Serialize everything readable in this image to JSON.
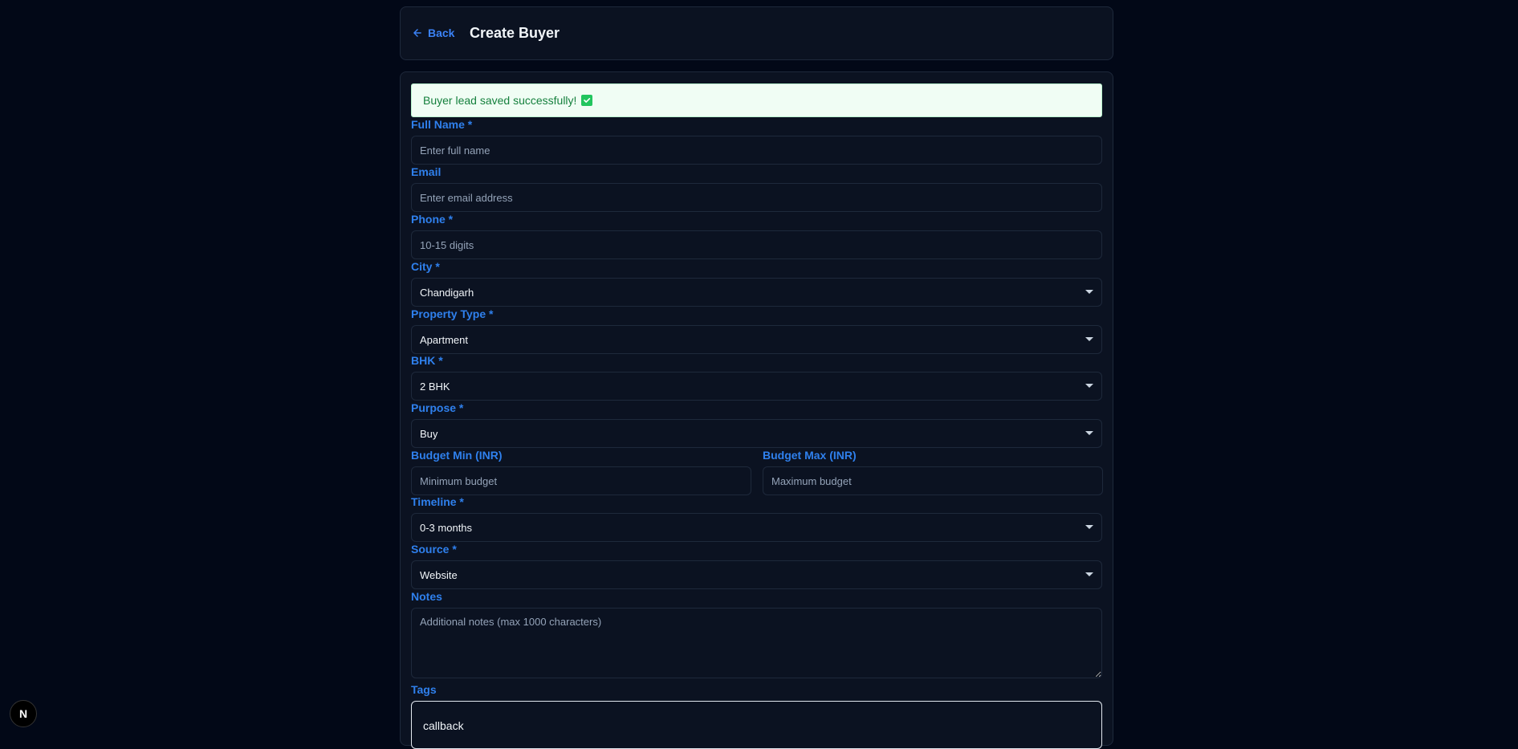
{
  "header": {
    "back_label": "Back",
    "title": "Create Buyer"
  },
  "alert": {
    "message": "Buyer lead saved successfully!"
  },
  "fields": {
    "full_name": {
      "label": "Full Name *",
      "placeholder": "Enter full name"
    },
    "email": {
      "label": "Email",
      "placeholder": "Enter email address"
    },
    "phone": {
      "label": "Phone *",
      "placeholder": "10-15 digits"
    },
    "city": {
      "label": "City *",
      "value": "Chandigarh"
    },
    "property_type": {
      "label": "Property Type *",
      "value": "Apartment"
    },
    "bhk": {
      "label": "BHK *",
      "value": "2 BHK"
    },
    "purpose": {
      "label": "Purpose *",
      "value": "Buy"
    },
    "budget_min": {
      "label": "Budget Min (INR)",
      "placeholder": "Minimum budget"
    },
    "budget_max": {
      "label": "Budget Max (INR)",
      "placeholder": "Maximum budget"
    },
    "timeline": {
      "label": "Timeline *",
      "value": "0-3 months"
    },
    "source": {
      "label": "Source *",
      "value": "Website"
    },
    "notes": {
      "label": "Notes",
      "placeholder": "Additional notes (max 1000 characters)"
    },
    "tags": {
      "label": "Tags",
      "value": "callback"
    }
  },
  "badge": {
    "text": "N"
  },
  "colors": {
    "background": "#020817",
    "accent": "#2f80ed",
    "success_bg": "#f0fdf4",
    "success_text": "#15803d"
  }
}
